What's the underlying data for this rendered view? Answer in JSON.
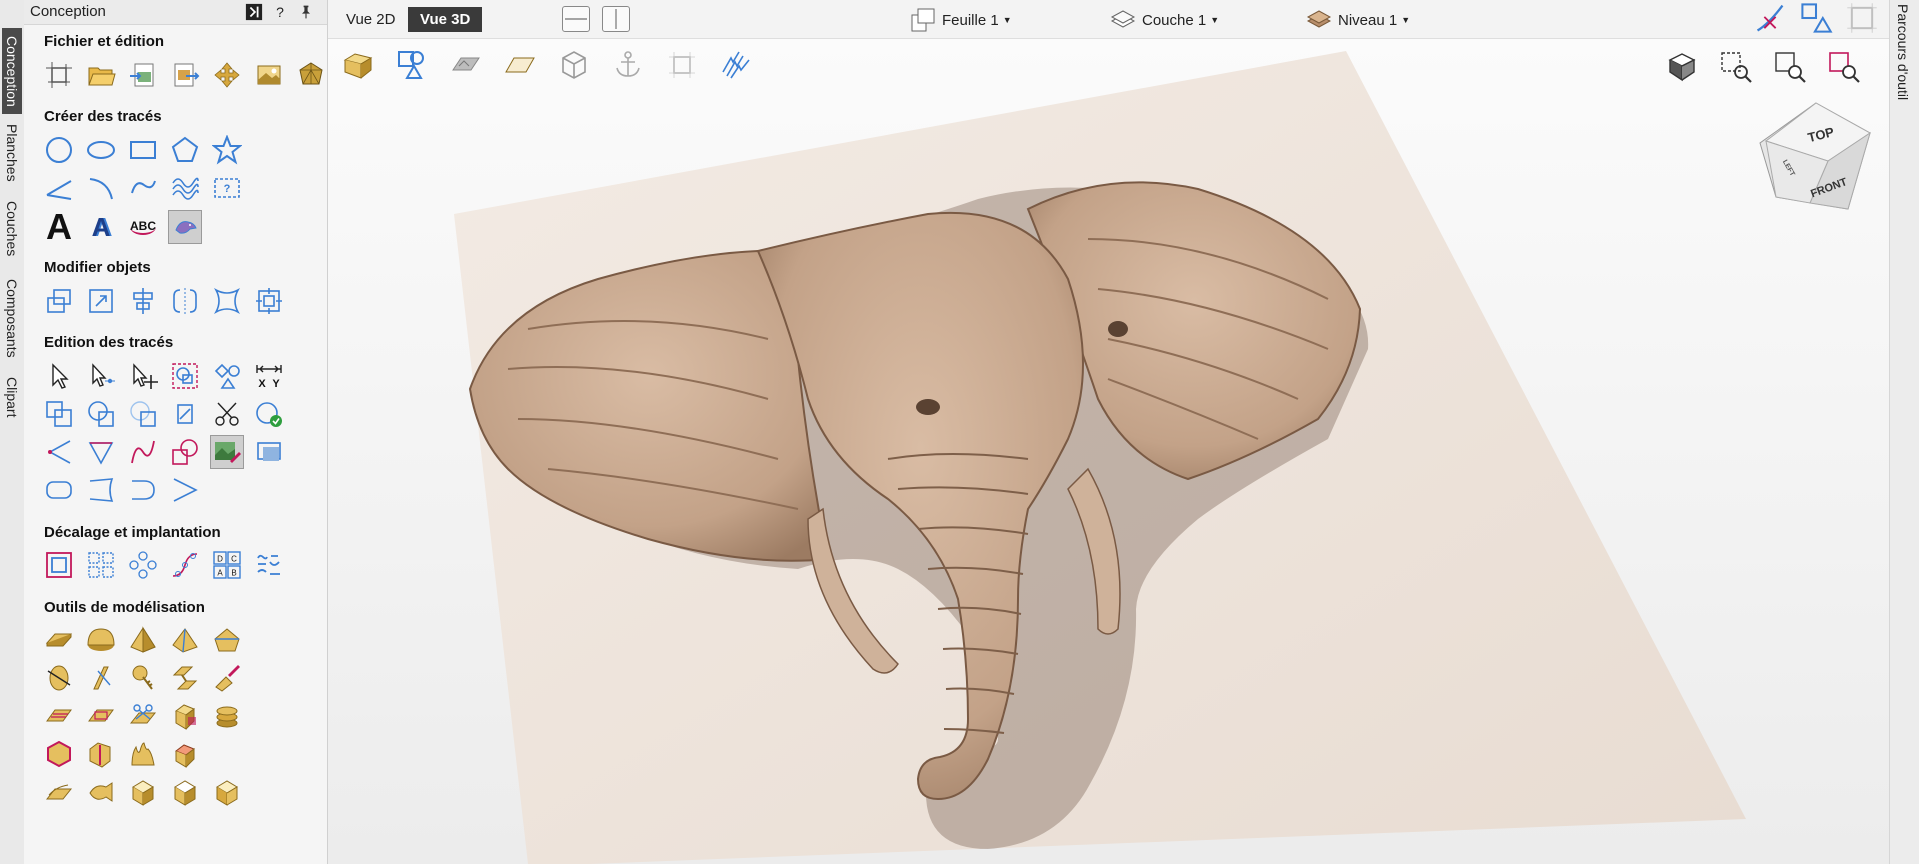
{
  "panel": {
    "title": "Conception",
    "help_label": "?",
    "sections": {
      "file": "Fichier et édition",
      "create": "Créer des tracés",
      "modify": "Modifier objets",
      "edit": "Edition des tracés",
      "offset": "Décalage et implantation",
      "model": "Outils de modélisation"
    },
    "text_tools": {
      "big_a": "A",
      "abc": "ABC",
      "x_label": "X",
      "y_label": "Y",
      "dc": "D C",
      "ab": "A B"
    }
  },
  "left_tabs": [
    "Conception",
    "Planches",
    "Couches",
    "Composants",
    "Clipart"
  ],
  "right_tab": "Parcours d'outil",
  "toolbar": {
    "view_2d": "Vue 2D",
    "view_3d": "Vue 3D",
    "sheet": "Feuille 1",
    "layer": "Couche 1",
    "level": "Niveau 1"
  },
  "viewcube": {
    "top": "TOP",
    "front": "FRONT",
    "left": "LEFT"
  },
  "colors": {
    "icon_blue": "#3b7fd4",
    "model_gold": "#d7a83e",
    "relief": "#c9a88f",
    "board": "#efe4dc"
  }
}
